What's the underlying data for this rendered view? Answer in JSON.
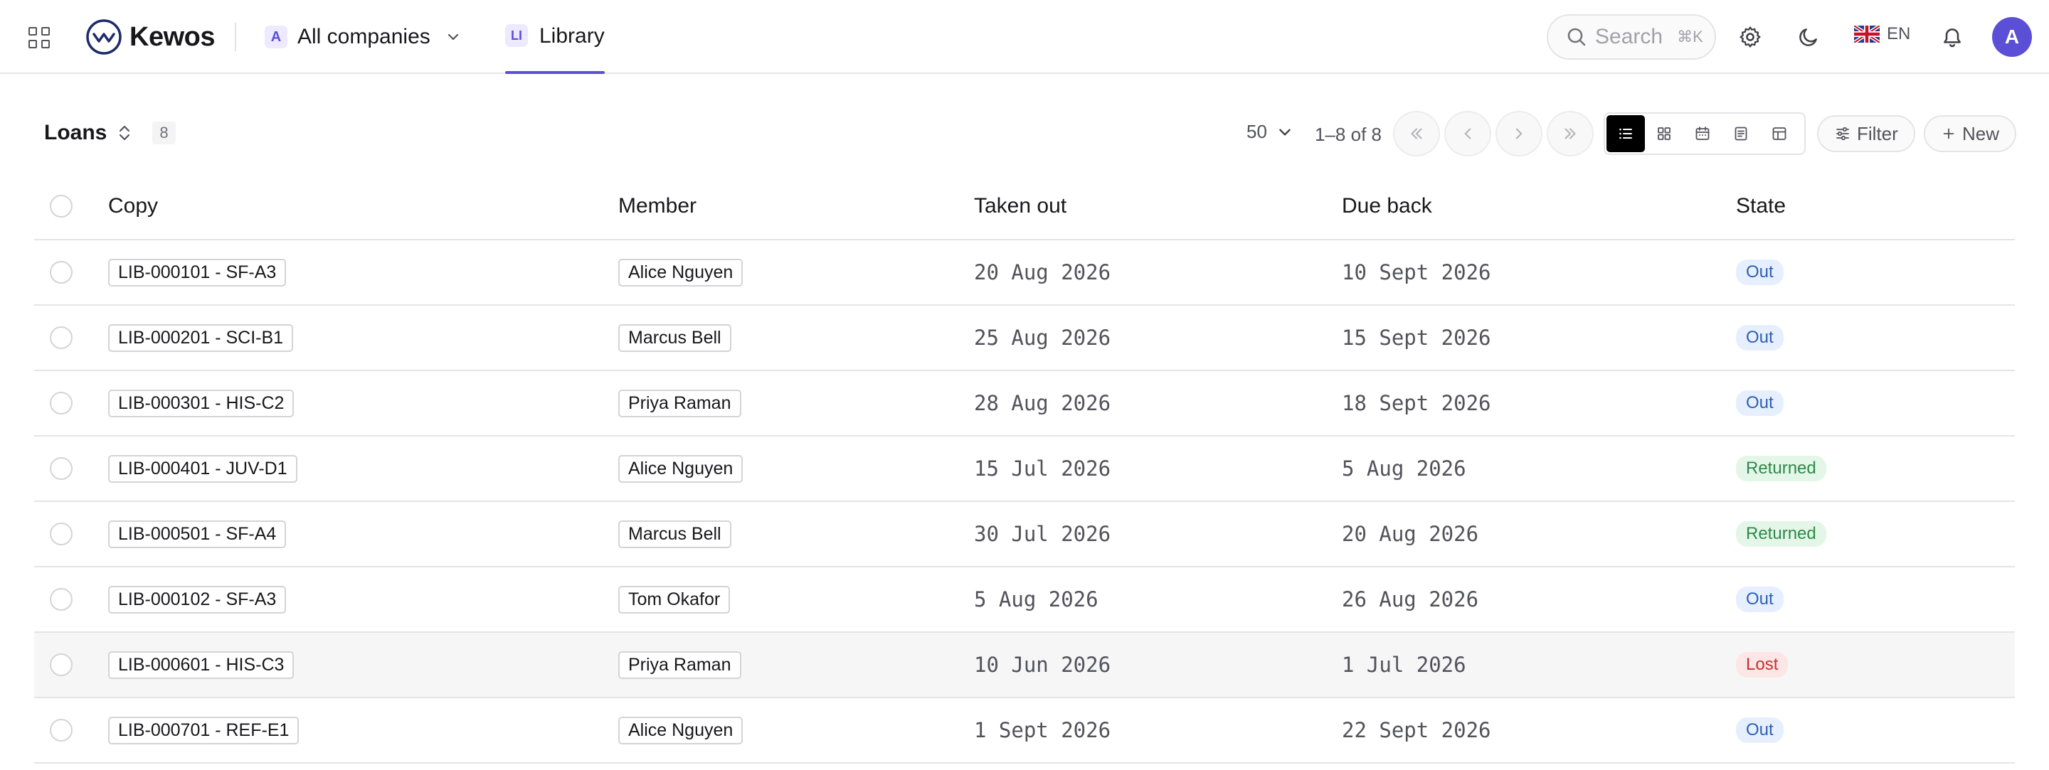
{
  "header": {
    "app_name": "Kewos",
    "company": {
      "badge": "A",
      "label": "All companies"
    },
    "tab": {
      "badge": "LI",
      "label": "Library"
    },
    "search": {
      "label": "Search",
      "shortcut": "⌘K"
    },
    "language": "EN",
    "avatar": "A"
  },
  "toolbar": {
    "title": "Loans",
    "count": "8",
    "page_size": "50",
    "range": "1–8 of 8",
    "filter_label": "Filter",
    "new_label": "New"
  },
  "table": {
    "columns": [
      "Copy",
      "Member",
      "Taken out",
      "Due back",
      "State"
    ],
    "rows": [
      {
        "copy": "LIB-000101 - SF-A3",
        "member": "Alice Nguyen",
        "taken_out": "20 Aug 2026",
        "due_back": "10 Sept 2026",
        "state": "Out"
      },
      {
        "copy": "LIB-000201 - SCI-B1",
        "member": "Marcus Bell",
        "taken_out": "25 Aug 2026",
        "due_back": "15 Sept 2026",
        "state": "Out"
      },
      {
        "copy": "LIB-000301 - HIS-C2",
        "member": "Priya Raman",
        "taken_out": "28 Aug 2026",
        "due_back": "18 Sept 2026",
        "state": "Out"
      },
      {
        "copy": "LIB-000401 - JUV-D1",
        "member": "Alice Nguyen",
        "taken_out": "15 Jul 2026",
        "due_back": "5 Aug 2026",
        "state": "Returned"
      },
      {
        "copy": "LIB-000501 - SF-A4",
        "member": "Marcus Bell",
        "taken_out": "30 Jul 2026",
        "due_back": "20 Aug 2026",
        "state": "Returned"
      },
      {
        "copy": "LIB-000102 - SF-A3",
        "member": "Tom Okafor",
        "taken_out": "5 Aug 2026",
        "due_back": "26 Aug 2026",
        "state": "Out"
      },
      {
        "copy": "LIB-000601 - HIS-C3",
        "member": "Priya Raman",
        "taken_out": "10 Jun 2026",
        "due_back": "1 Jul 2026",
        "state": "Lost"
      },
      {
        "copy": "LIB-000701 - REF-E1",
        "member": "Alice Nguyen",
        "taken_out": "1 Sept 2026",
        "due_back": "22 Sept 2026",
        "state": "Out"
      }
    ]
  },
  "state_colors": {
    "Out": {
      "bg": "#e6effd",
      "fg": "#2f5fb3"
    },
    "Returned": {
      "bg": "#e3f6e8",
      "fg": "#2e8a4a"
    },
    "Lost": {
      "bg": "#fde6e6",
      "fg": "#c53030"
    }
  },
  "icons": [
    "apps-grid-icon",
    "kewos-logo-icon",
    "chevron-down-icon",
    "search-icon",
    "gear-icon",
    "moon-icon",
    "uk-flag-icon",
    "bell-icon",
    "sort-icon",
    "first-page-icon",
    "prev-page-icon",
    "next-page-icon",
    "last-page-icon",
    "list-view-icon",
    "grid-view-icon",
    "calendar-view-icon",
    "document-view-icon",
    "table-view-icon",
    "filter-icon",
    "plus-icon"
  ]
}
